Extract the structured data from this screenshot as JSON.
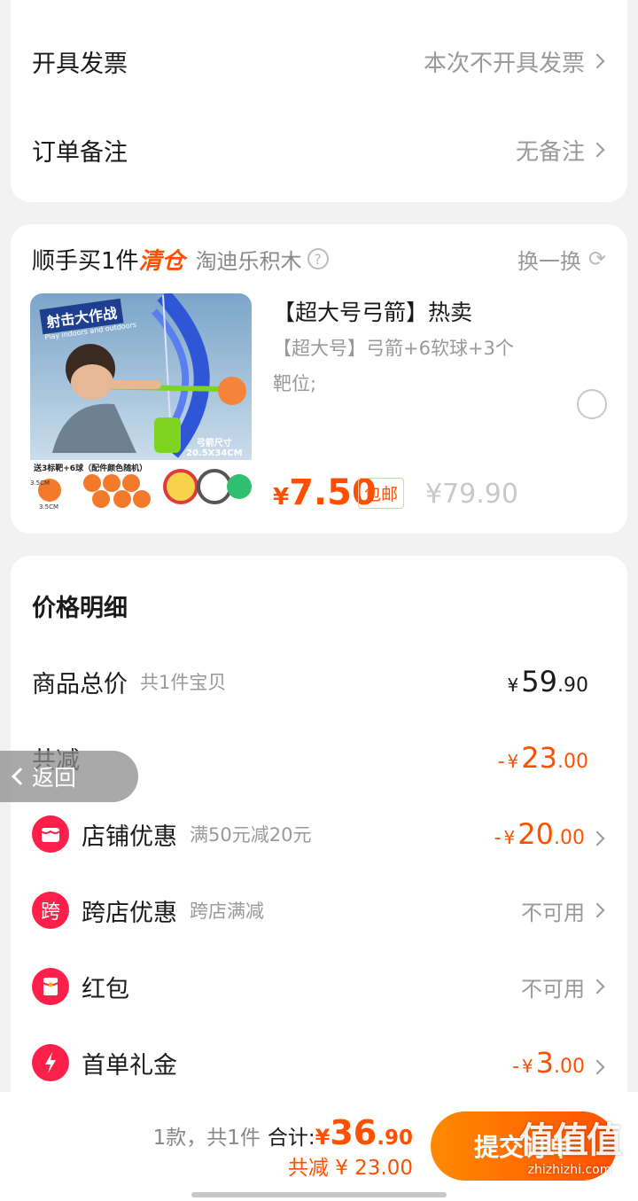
{
  "invoice": {
    "label": "开具发票",
    "value": "本次不开具发票"
  },
  "remark": {
    "label": "订单备注",
    "value": "无备注"
  },
  "addon": {
    "title_prefix": "顺手买1件",
    "title_highlight": "清仓",
    "shop": "淘迪乐积木",
    "refresh_label": "换一换",
    "product": {
      "name": "【超大号弓箭】热卖",
      "spec_line1": "【超大号】弓箭+6软球+3个",
      "spec_line2": "靶位;",
      "price_symbol": "¥",
      "price": "7.50",
      "shipping_tag": "包邮",
      "orig_price": "¥79.90",
      "image_texts": {
        "banner": "射击大作战",
        "banner_sub": "Play indoors and outdoors",
        "size_label": "弓箭尺寸",
        "size_value": "20.5X34CM",
        "accessory": "送3标靶+6球（配件颜色随机）",
        "ball_size_v": "3.5CM",
        "ball_size_h": "3.5CM"
      }
    }
  },
  "price_detail": {
    "title": "价格明细",
    "goods_total": {
      "label": "商品总价",
      "sub": "共1件宝贝",
      "currency": "¥",
      "int": "59",
      "dec": ".90"
    },
    "total_reduce": {
      "label": "共减",
      "prefix": "-",
      "currency": "¥",
      "int": "23",
      "dec": ".00"
    },
    "shop_discount": {
      "label": "店铺优惠",
      "sub": "满50元减20元",
      "prefix": "-",
      "currency": "¥",
      "int": "20",
      "dec": ".00"
    },
    "cross_store": {
      "label": "跨店优惠",
      "sub": "跨店满减",
      "value": "不可用",
      "icon_char": "跨"
    },
    "red_packet": {
      "label": "红包",
      "value": "不可用"
    },
    "first_order": {
      "label": "首单礼金",
      "prefix": "-",
      "currency": "¥",
      "int": "3",
      "dec": ".00"
    }
  },
  "back_button": {
    "label": "返回"
  },
  "footer": {
    "count_text": "1款，共1件",
    "total_label": "合计:",
    "total_currency": "¥",
    "total_int": "36",
    "total_dec": ".90",
    "reduce_text": "共减 ¥ 23.00",
    "submit_label": "提交订单",
    "watermark": "值值值",
    "watermark_url": "zhizhizhi.com"
  },
  "colors": {
    "accent": "#ff5000",
    "red": "#ff1f4b",
    "bg": "#f2f2f2"
  }
}
